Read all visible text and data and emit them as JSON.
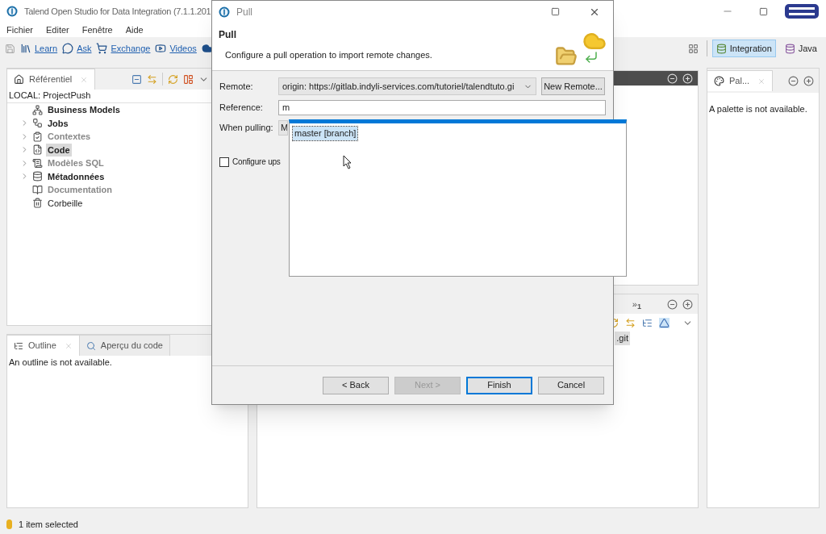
{
  "window": {
    "title": "Talend Open Studio for Data Integration (7.1.1.201"
  },
  "menu": [
    "Fichier",
    "Editer",
    "Fenêtre",
    "Aide"
  ],
  "toolbar": {
    "links": [
      "Learn",
      "Ask",
      "Exchange",
      "Videos"
    ],
    "perspectives": [
      {
        "label": "Integration",
        "selected": true
      },
      {
        "label": "Java",
        "selected": false
      }
    ]
  },
  "repository_panel": {
    "tab": "Référentiel",
    "project": "LOCAL: ProjectPush",
    "items": [
      {
        "label": "Business Models",
        "kind": "bold",
        "expandable": false,
        "selected": false
      },
      {
        "label": "Jobs",
        "kind": "bold",
        "expandable": true,
        "selected": false
      },
      {
        "label": "Contextes",
        "kind": "muted",
        "expandable": true,
        "selected": false
      },
      {
        "label": "Code",
        "kind": "bold",
        "expandable": true,
        "selected": true
      },
      {
        "label": "Modèles SQL",
        "kind": "muted",
        "expandable": true,
        "selected": false
      },
      {
        "label": "Métadonnées",
        "kind": "bold",
        "expandable": true,
        "selected": false
      },
      {
        "label": "Documentation",
        "kind": "muted",
        "expandable": false,
        "selected": false
      },
      {
        "label": "Corbeille",
        "kind": "normal",
        "expandable": false,
        "selected": false
      }
    ]
  },
  "outline_panel": {
    "tabs": [
      {
        "label": "Outline",
        "selected": true
      },
      {
        "label": "Aperçu du code",
        "selected": false
      }
    ],
    "message": "An outline is not available."
  },
  "lower_panel": {
    "overflow": "»",
    "count": "1",
    "item": ".git"
  },
  "palette_panel": {
    "tab": "Pal...",
    "message": "A palette is not available."
  },
  "status_bar": "1 item selected",
  "dialog": {
    "title": "Pull",
    "heading": "Pull",
    "description": "Configure a pull operation to import remote changes.",
    "remote": {
      "label": "Remote:",
      "value": "origin: https://gitlab.indyli-services.com/tutoriel/talendtuto.gi",
      "button": "New Remote..."
    },
    "reference": {
      "label": "Reference:",
      "value": "m"
    },
    "when_pulling": {
      "label": "When pulling:",
      "value": "M"
    },
    "configure_upstream": {
      "label": "Configure ups",
      "checked": false
    },
    "buttons": [
      {
        "label": "< Back",
        "disabled": false,
        "default": false
      },
      {
        "label": "Next >",
        "disabled": true,
        "default": false
      },
      {
        "label": "Finish",
        "disabled": false,
        "default": true
      },
      {
        "label": "Cancel",
        "disabled": false,
        "default": false
      }
    ],
    "suggestions": [
      {
        "label": "master [branch]",
        "selected": true
      }
    ]
  }
}
